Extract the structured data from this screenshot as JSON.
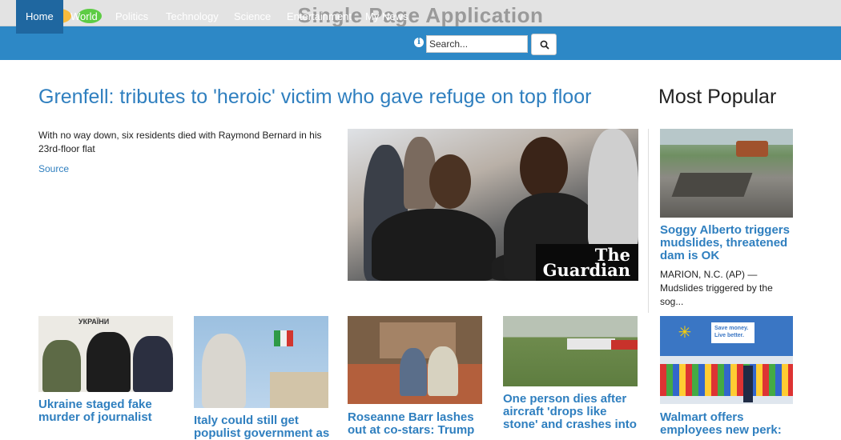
{
  "window": {
    "title": "Single Page Application"
  },
  "nav": {
    "items": [
      "Home",
      "World",
      "Politics",
      "Technology",
      "Science",
      "Entertainment",
      "My News"
    ],
    "active": "Home",
    "search_placeholder": "Search..."
  },
  "featured": {
    "headline": "Grenfell: tributes to 'heroic' victim who gave refuge on top floor",
    "summary": "With no way down, six residents died with Raymond Bernard in his 23rd-floor flat",
    "source_label": "Source",
    "image_logo": "The Guardian"
  },
  "popular": {
    "heading": "Most Popular",
    "items": [
      {
        "title": "Soggy Alberto triggers mudslides, threatened dam is OK",
        "snippet": "MARION, N.C. (AP) — Mudslides triggered by the sog..."
      },
      {
        "title": "Walmart offers employees new perk:",
        "image_sign": "Save money. Live better."
      }
    ]
  },
  "cards": [
    {
      "title": "Ukraine staged fake murder of journalist",
      "image_sign": "УКРАЇНИ"
    },
    {
      "title": "Italy could still get populist government as"
    },
    {
      "title": "Roseanne Barr lashes out at co-stars: Trump"
    },
    {
      "title": "One person dies after aircraft 'drops like stone' and crashes into"
    }
  ],
  "colors": {
    "navbar": "#2d88c6",
    "nav_active": "#1f67a0",
    "link": "#2f7fbf",
    "titlebar": "#e3e3e3"
  }
}
